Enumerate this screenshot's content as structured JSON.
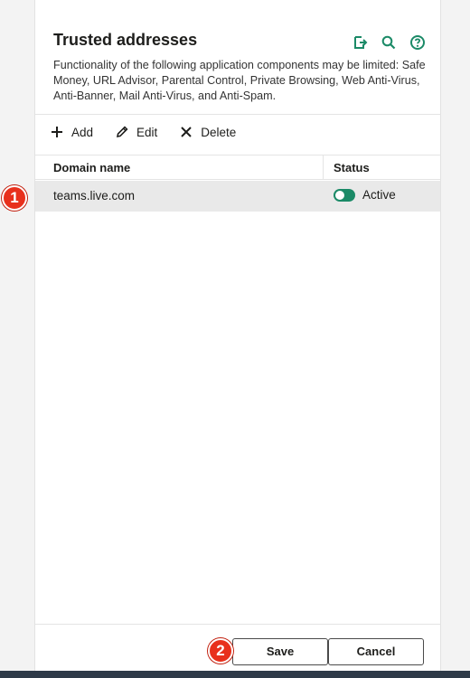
{
  "header": {
    "title": "Trusted addresses",
    "description": "Functionality of the following application components may be limited: Safe Money, URL Advisor, Parental Control, Private Browsing, Web Anti-Virus, Anti-Banner, Mail Anti-Virus, and Anti-Spam.",
    "icons": [
      "export-icon",
      "search-icon",
      "help-icon"
    ]
  },
  "toolbar": {
    "add_label": "Add",
    "edit_label": "Edit",
    "delete_label": "Delete"
  },
  "table": {
    "columns": [
      "Domain name",
      "Status"
    ],
    "rows": [
      {
        "domain": "teams.live.com",
        "status": "Active",
        "enabled": true
      }
    ]
  },
  "footer": {
    "save_label": "Save",
    "cancel_label": "Cancel"
  },
  "annotations": {
    "badge_1": "1",
    "badge_2": "2"
  },
  "colors": {
    "accent": "#1b8a67",
    "badge": "#e8301c"
  }
}
